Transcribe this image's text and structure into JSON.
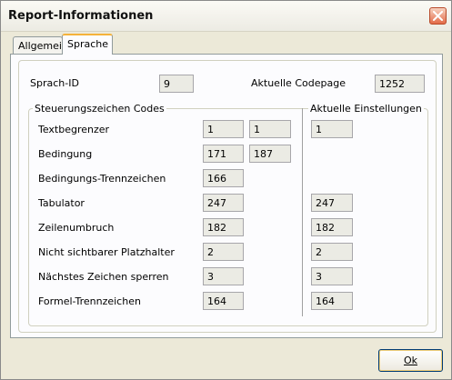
{
  "window": {
    "title": "Report-Informationen"
  },
  "tabs": [
    {
      "label": "Allgemein",
      "active": false
    },
    {
      "label": "Sprache",
      "active": true
    }
  ],
  "language": {
    "sprach_id_label": "Sprach-ID",
    "sprach_id_value": "9",
    "codepage_label": "Aktuelle Codepage",
    "codepage_value": "1252"
  },
  "control_codes": {
    "title": "Steuerungszeichen Codes",
    "current_title": "Aktuelle Einstellungen",
    "rows": [
      {
        "label": "Textbegrenzer",
        "code1": "1",
        "code2": "1",
        "current": "1"
      },
      {
        "label": "Bedingung",
        "code1": "171",
        "code2": "187",
        "current": ""
      },
      {
        "label": "Bedingungs-Trennzeichen",
        "code1": "166",
        "code2": "",
        "current": ""
      },
      {
        "label": "Tabulator",
        "code1": "247",
        "code2": "",
        "current": "247"
      },
      {
        "label": "Zeilenumbruch",
        "code1": "182",
        "code2": "",
        "current": "182"
      },
      {
        "label": "Nicht sichtbarer Platzhalter",
        "code1": "2",
        "code2": "",
        "current": "2"
      },
      {
        "label": "Nächstes Zeichen sperren",
        "code1": "3",
        "code2": "",
        "current": "3"
      },
      {
        "label": "Formel-Trennzeichen",
        "code1": "164",
        "code2": "",
        "current": "164"
      }
    ]
  },
  "buttons": {
    "ok_label": "Ok"
  },
  "icons": {
    "close": "close-icon"
  },
  "colors": {
    "tab_highlight": "#f5b23a",
    "close_button": "#e36b48",
    "field_bg": "#ebebe4"
  }
}
